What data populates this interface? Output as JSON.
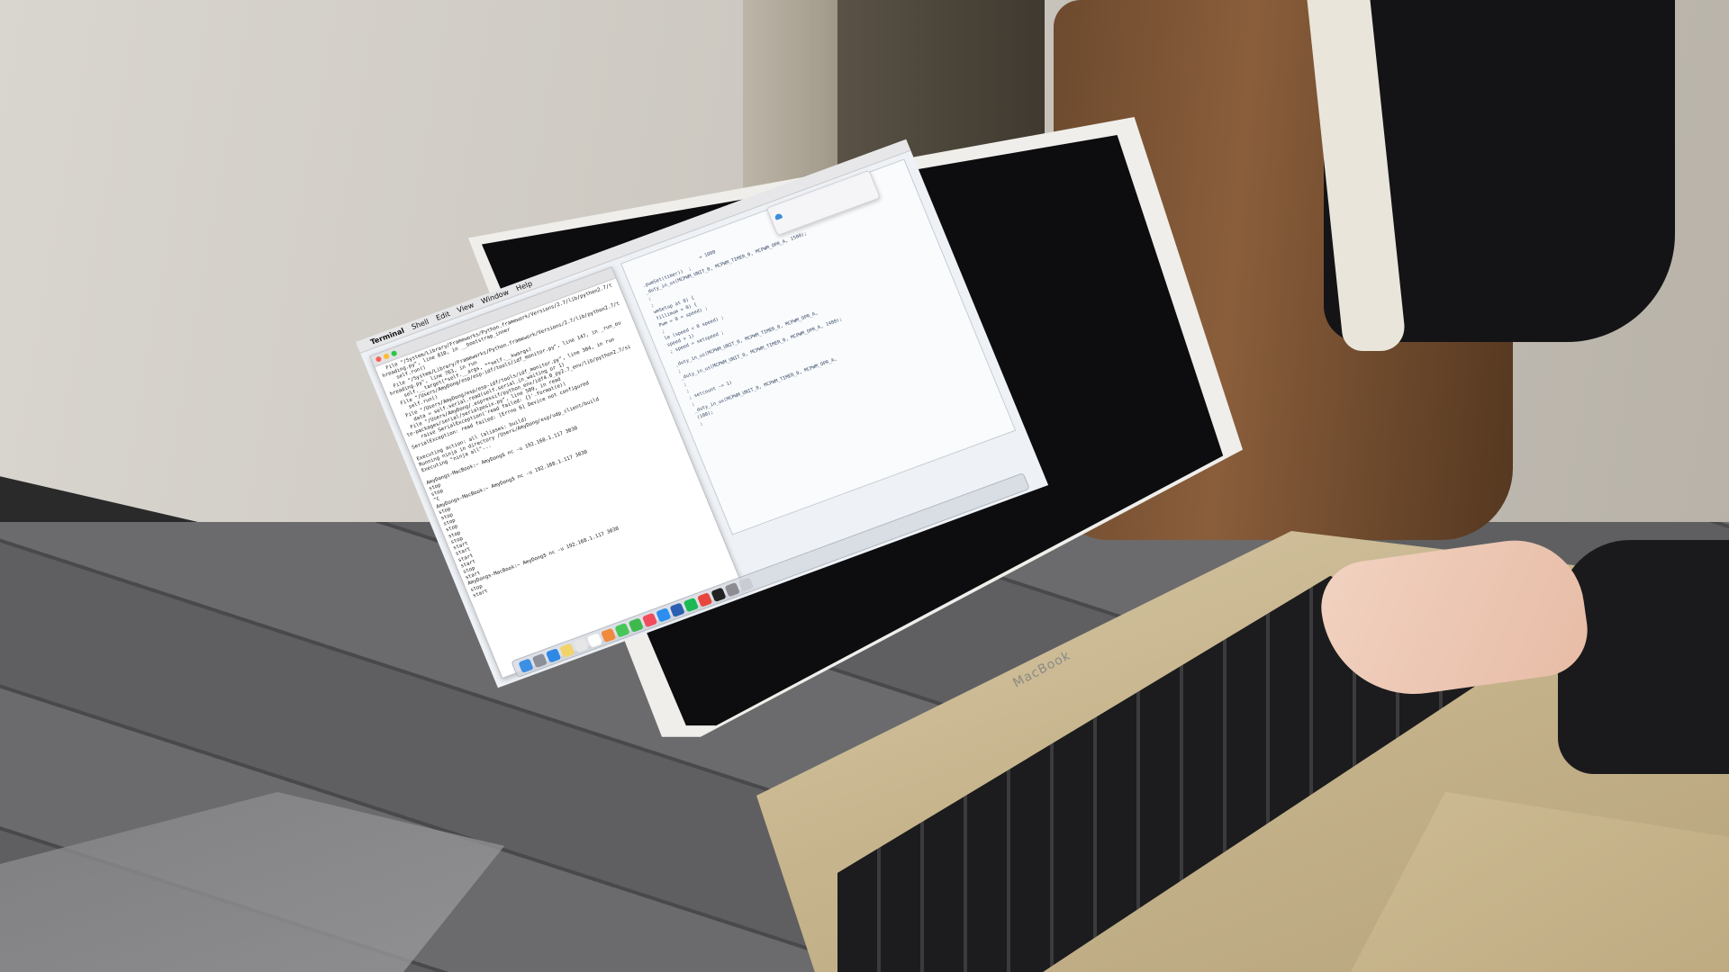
{
  "screen": {
    "menubar": {
      "apple_glyph": "",
      "items": [
        "Terminal",
        "Shell",
        "Edit",
        "View",
        "Window",
        "Help"
      ]
    },
    "terminal": {
      "title": "",
      "lines": [
        "  File \"/System/Library/Frameworks/Python.framework/Versions/2.7/lib/python2.7/t",
        "hreading.py\", line 810, in __bootstrap_inner",
        "    self.run()",
        "  File \"/System/Library/Frameworks/Python.framework/Versions/2.7/lib/python2.7/t",
        "hreading.py\", line 763, in run",
        "    self.__target(*self.__args, **self.__kwargs)",
        "  File \"/Users/AmyDong/esp/esp-idf/tools/idf_monitor.py\", line 147, in _run_ou",
        "    self.run()",
        "  File \"/Users/AmyDong/esp/esp-idf/tools/idf_monitor.py\", line 304, in run",
        "    data = self.serial.read(self.serial.in_waiting or 1)",
        "  File \"/Users/AmyDong/.espressif/python_env/idf4.0_py2.7_env/lib/python2.7/si",
        "te-packages/serial/serialposix.py\", line 509, in read",
        "    raise SerialException('read failed: {}'.format(e))",
        "SerialException: read failed: [Errno 6] Device not configured",
        "",
        "Executing action: all (aliases: build)",
        "Running ninja in directory /Users/AmyDong/esp/udp_client/build",
        "Executing \"ninja all\"...",
        "",
        "AmyDongs-MacBook:~ AmyDong$ nc -u 192.168.1.117 3030",
        "stop",
        "stop",
        "^C",
        "AmyDongs-MacBook:~ AmyDong$ nc -u 192.168.1.117 3030",
        "stop",
        "stop",
        "stop",
        "stop",
        "stop",
        "stop",
        "start",
        "start",
        "start",
        "start",
        "stop",
        "start",
        "AmyDongs-MacBook:~ AmyDong$ nc -u 192.168.1.117 3030",
        "stop",
        "start"
      ]
    },
    "editor": {
      "lines": [
        "                        = 1000",
        "  .pwmSet(timer))  ;",
        "  _duty_in_us(MCPWM_UNIT_0, MCPWM_TIMER_0, MCPWM_OPR_A, 1500);",
        "  ;",
        "  ;",
        "  wmSetup at 0) {",
        "  fillimum = 0) {",
        "  Pwm = 0 = speed) ;",
        "  ;",
        "  le (speed < 0 speed) ;",
        "  speed + 1)",
        "  ; speed = setspeed ;",
        "",
        "  _duty_in_us(MCPWM_UNIT_0, MCPWM_TIMER_0, MCPWM_OPR_A,",
        "  ;",
        "  _duty_in_us(MCPWM_UNIT_0, MCPWM_TIMER_0, MCPWM_OPR_A, 1400);",
        "  ;",
        "  ;",
        "  ; setcount -= 1)",
        "  ;",
        "  _duty_in_us(MCPWM_UNIT_0, MCPWM_TIMER_0, MCPWM_OPR_A,",
        "  (100);",
        "  ;"
      ]
    },
    "notification": {
      "title": "",
      "body": ""
    },
    "dock_icons": [
      {
        "name": "finder-icon",
        "color": "#3d8fe3"
      },
      {
        "name": "launchpad-icon",
        "color": "#8a8f99"
      },
      {
        "name": "safari-icon",
        "color": "#2f88e6"
      },
      {
        "name": "notes-icon",
        "color": "#f2d26a"
      },
      {
        "name": "preview-icon",
        "color": "#e6e6e6"
      },
      {
        "name": "calendar-icon",
        "color": "#ffffff"
      },
      {
        "name": "photos-icon",
        "color": "#f08a3c"
      },
      {
        "name": "messages-icon",
        "color": "#47c65a"
      },
      {
        "name": "facetime-icon",
        "color": "#3fb94f"
      },
      {
        "name": "music-icon",
        "color": "#f04c5c"
      },
      {
        "name": "appstore-icon",
        "color": "#2b8ef0"
      },
      {
        "name": "word-icon",
        "color": "#2b5fb3"
      },
      {
        "name": "spotify-icon",
        "color": "#1db954"
      },
      {
        "name": "chrome-icon",
        "color": "#e8453c"
      },
      {
        "name": "terminal-icon",
        "color": "#222222"
      },
      {
        "name": "settings-icon",
        "color": "#8c8c92"
      },
      {
        "name": "trash-icon",
        "color": "#c9ccd2"
      }
    ]
  },
  "laptop": {
    "brand": "MacBook"
  }
}
